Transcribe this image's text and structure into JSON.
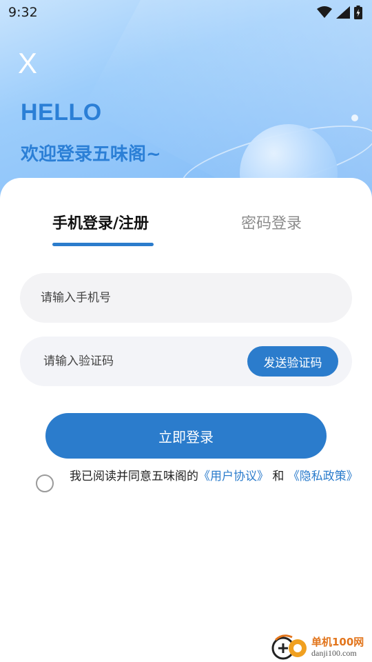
{
  "status_bar": {
    "time": "9:32"
  },
  "header": {
    "close_label": "X",
    "greeting": "HELLO",
    "welcome": "欢迎登录五味阁~"
  },
  "tabs": [
    {
      "label": "手机登录/注册",
      "active": true
    },
    {
      "label": "密码登录",
      "active": false
    }
  ],
  "form": {
    "phone_placeholder": "请输入手机号",
    "phone_value": "",
    "code_placeholder": "请输入验证码",
    "code_value": "",
    "send_code_label": "发送验证码",
    "login_label": "立即登录"
  },
  "agreement": {
    "checked": false,
    "prefix": "我已阅读并同意五味阁的",
    "user_agreement": "《用户协议》",
    "conjunction": " 和 ",
    "privacy_policy": "《隐私政策》"
  },
  "watermark": {
    "cn": "单机100网",
    "en": "danji100.com"
  },
  "colors": {
    "accent": "#2b7ccc",
    "heading": "#2b7fd6"
  }
}
